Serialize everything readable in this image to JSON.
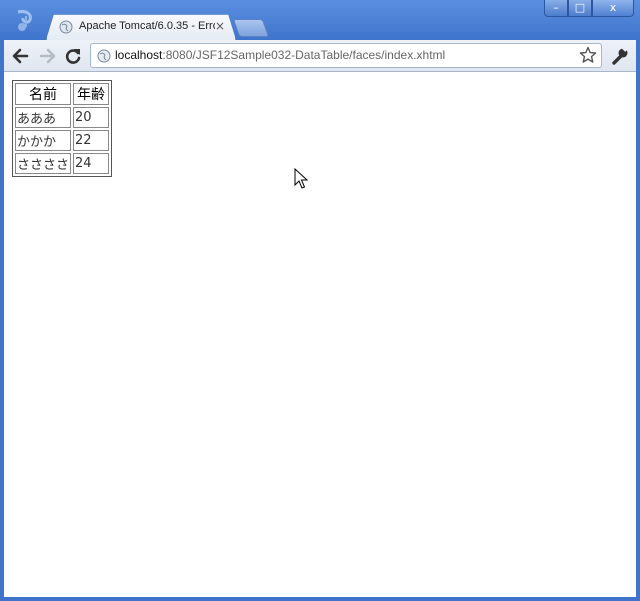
{
  "browser": {
    "tab_title": "Apache Tomcat/6.0.35 - Erro",
    "tab_close": "×",
    "url_host": "localhost",
    "url_rest": ":8080/JSF12Sample032-DataTable/faces/index.xhtml",
    "minimize": "–",
    "maximize": "□",
    "close": "x"
  },
  "table": {
    "headers": [
      "名前",
      "年齢"
    ],
    "rows": [
      [
        "あああ",
        "20"
      ],
      [
        "かかか",
        "22"
      ],
      [
        "ささささ",
        "24"
      ]
    ]
  },
  "colors": {
    "frame": "#3f74cc",
    "toolbar": "#e6ecf4"
  },
  "icons": [
    "chrome-logo-icon",
    "globe-icon",
    "back-arrow-icon",
    "forward-arrow-icon",
    "reload-icon",
    "star-icon",
    "wrench-icon",
    "mouse-cursor-icon"
  ]
}
